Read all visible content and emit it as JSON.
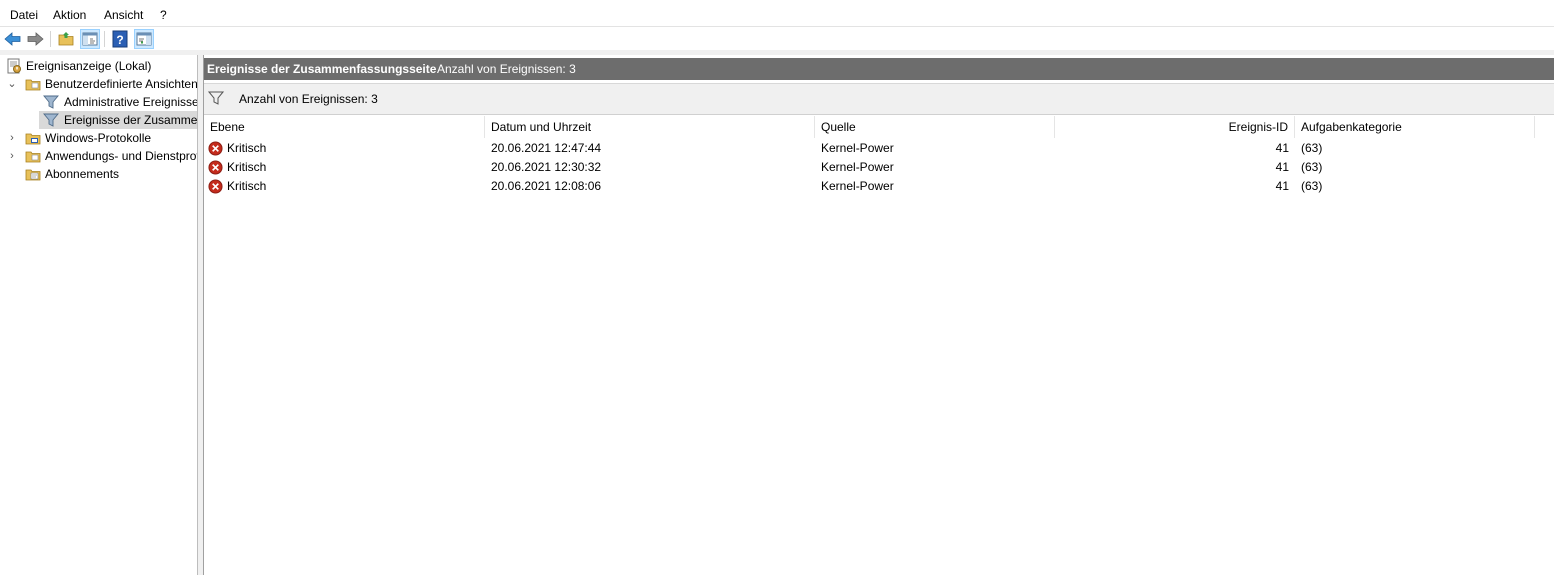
{
  "menu": {
    "items": [
      "Datei",
      "Aktion",
      "Ansicht",
      "?"
    ]
  },
  "toolbar": {
    "buttons": [
      "back-icon",
      "forward-icon",
      "open-folder-icon",
      "show-hide-console-tree-icon",
      "help-icon",
      "show-hide-action-pane-icon"
    ]
  },
  "tree": {
    "items": [
      {
        "label": "Ereignisanzeige (Lokal)",
        "icon": "event-viewer-icon"
      },
      {
        "label": "Benutzerdefinierte Ansichten",
        "icon": "folder-icon",
        "expanded": true
      },
      {
        "label": "Administrative Ereignisse",
        "icon": "filter-icon"
      },
      {
        "label": "Ereignisse der Zusammenfassungsseite",
        "icon": "filter-icon",
        "selected": true
      },
      {
        "label": "Windows-Protokolle",
        "icon": "folder-log-icon",
        "expanded": false
      },
      {
        "label": "Anwendungs- und Dienstprotokolle",
        "icon": "folder-icon",
        "expanded": false
      },
      {
        "label": "Abonnements",
        "icon": "subscription-icon"
      }
    ]
  },
  "content": {
    "title": "Ereignisse der Zusammenfassungsseite",
    "count_text": "Anzahl von Ereignissen: 3",
    "filter_text": "Anzahl von Ereignissen: 3"
  },
  "grid": {
    "columns": [
      "Ebene",
      "Datum und Uhrzeit",
      "Quelle",
      "Ereignis-ID",
      "Aufgabenkategorie"
    ],
    "rows": [
      {
        "level": "Kritisch",
        "datetime": "20.06.2021 12:47:44",
        "source": "Kernel-Power",
        "event_id": "41",
        "category": "(63)"
      },
      {
        "level": "Kritisch",
        "datetime": "20.06.2021 12:30:32",
        "source": "Kernel-Power",
        "event_id": "41",
        "category": "(63)"
      },
      {
        "level": "Kritisch",
        "datetime": "20.06.2021 12:08:06",
        "source": "Kernel-Power",
        "event_id": "41",
        "category": "(63)"
      }
    ]
  },
  "colors": {
    "title_bar": "#6d6d6d",
    "selection": "#d9d9d9",
    "critical": "#c42b1c",
    "toolbar_pressed": "#cce8ff"
  }
}
